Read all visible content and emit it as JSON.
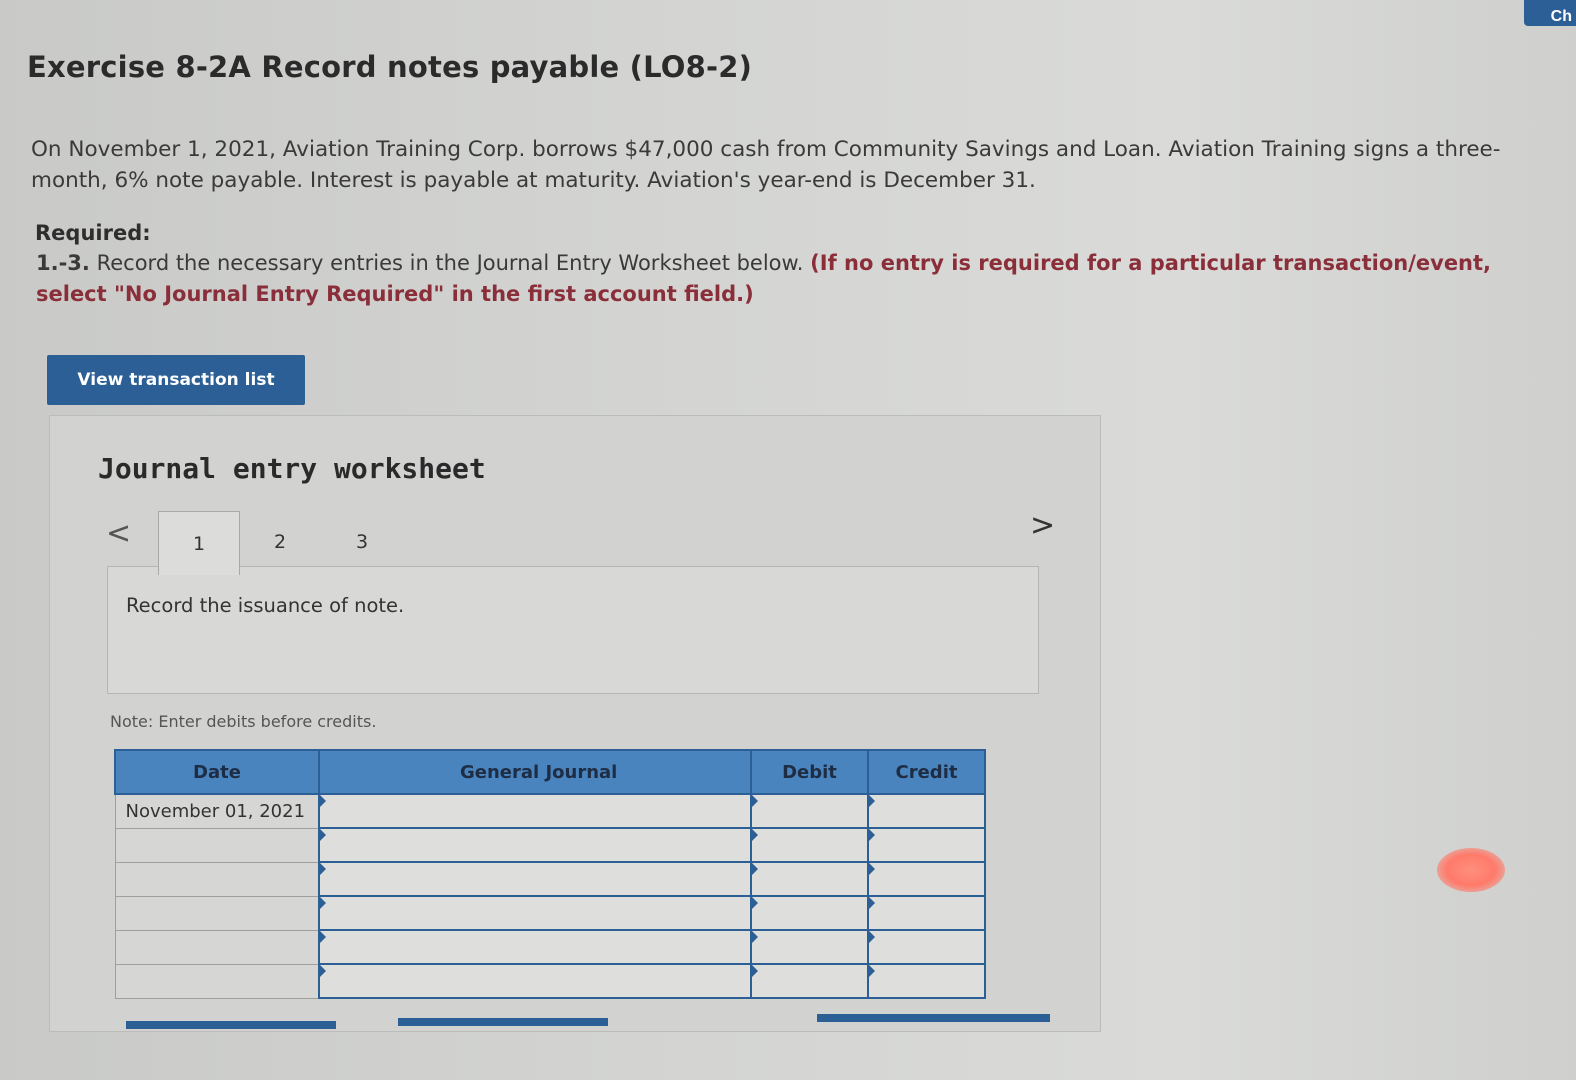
{
  "exercise": {
    "title": "Exercise 8-2A Record notes payable (LO8-2)",
    "problem": "On November 1, 2021, Aviation Training Corp. borrows $47,000 cash from Community Savings and Loan. Aviation Training signs a three-month, 6% note payable. Interest is payable at maturity. Aviation's year-end is December 31.",
    "required_label": "Required:",
    "required_number": "1.-3.",
    "required_text": "Record the necessary entries in the Journal Entry Worksheet below.",
    "required_note": "(If no entry is required for a particular transaction/event, select \"No Journal Entry Required\" in the first account field.)"
  },
  "toolbar": {
    "view_transaction_list": "View transaction list"
  },
  "worksheet": {
    "title": "Journal entry worksheet",
    "prev_arrow": "<",
    "next_arrow": ">",
    "tabs": [
      {
        "label": "1"
      },
      {
        "label": "2"
      },
      {
        "label": "3"
      }
    ],
    "instruction": "Record the issuance of note.",
    "note": "Note: Enter debits before credits.",
    "columns": {
      "date": "Date",
      "general_journal": "General Journal",
      "debit": "Debit",
      "credit": "Credit"
    },
    "rows": [
      {
        "date": "November 01, 2021",
        "account": "",
        "debit": "",
        "credit": ""
      },
      {
        "date": "",
        "account": "",
        "debit": "",
        "credit": ""
      },
      {
        "date": "",
        "account": "",
        "debit": "",
        "credit": ""
      },
      {
        "date": "",
        "account": "",
        "debit": "",
        "credit": ""
      },
      {
        "date": "",
        "account": "",
        "debit": "",
        "credit": ""
      },
      {
        "date": "",
        "account": "",
        "debit": "",
        "credit": ""
      }
    ]
  },
  "colors": {
    "accent": "#2c5f95",
    "header_blue": "#4a84bf",
    "required_red": "#8a2f3a"
  }
}
